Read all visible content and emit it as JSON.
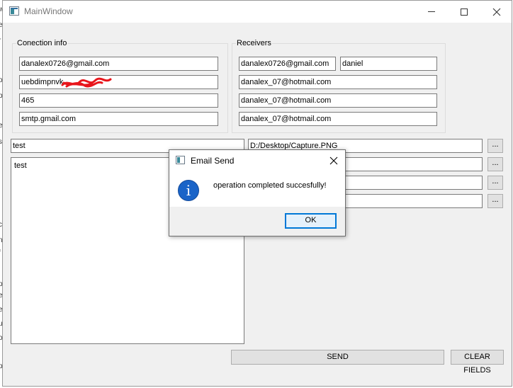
{
  "window": {
    "title": "MainWindow"
  },
  "connection": {
    "group_title": "Conection info",
    "email": "danalex0726@gmail.com",
    "password": "uebdimpnvk",
    "port": "465",
    "server": "smtp.gmail.com"
  },
  "receivers": {
    "group_title": "Receivers",
    "email1": "danalex0726@gmail.com",
    "name1": "daniel",
    "email2": "danalex_07@hotmail.com",
    "email3": "danalex_07@hotmail.com",
    "email4": "danalex_07@hotmail.com"
  },
  "message": {
    "subject": "test",
    "body": "test"
  },
  "attachments": {
    "file1": "D:/Desktop/Capture.PNG",
    "browse_label": "..."
  },
  "buttons": {
    "send": "SEND",
    "clear": "CLEAR FIELDS"
  },
  "dialog": {
    "title": "Email Send",
    "message": "operation completed succesfully!",
    "ok": "OK",
    "icon": "info-icon"
  },
  "colors": {
    "accent": "#0078d7",
    "info_icon": "#1a64c8",
    "scribble": "#e8151b"
  }
}
